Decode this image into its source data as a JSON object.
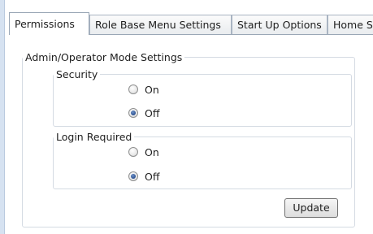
{
  "tabs": [
    {
      "label": "Permissions",
      "active": true
    },
    {
      "label": "Role Base Menu Settings",
      "active": false
    },
    {
      "label": "Start Up Options",
      "active": false
    },
    {
      "label": "Home Se",
      "active": false
    }
  ],
  "main_group": {
    "title": "Admin/Operator Mode Settings",
    "security": {
      "title": "Security",
      "options": [
        "On",
        "Off"
      ],
      "selected": "Off"
    },
    "login": {
      "title": "Login Required",
      "options": [
        "On",
        "Off"
      ],
      "selected": "Off"
    },
    "update_label": "Update"
  }
}
